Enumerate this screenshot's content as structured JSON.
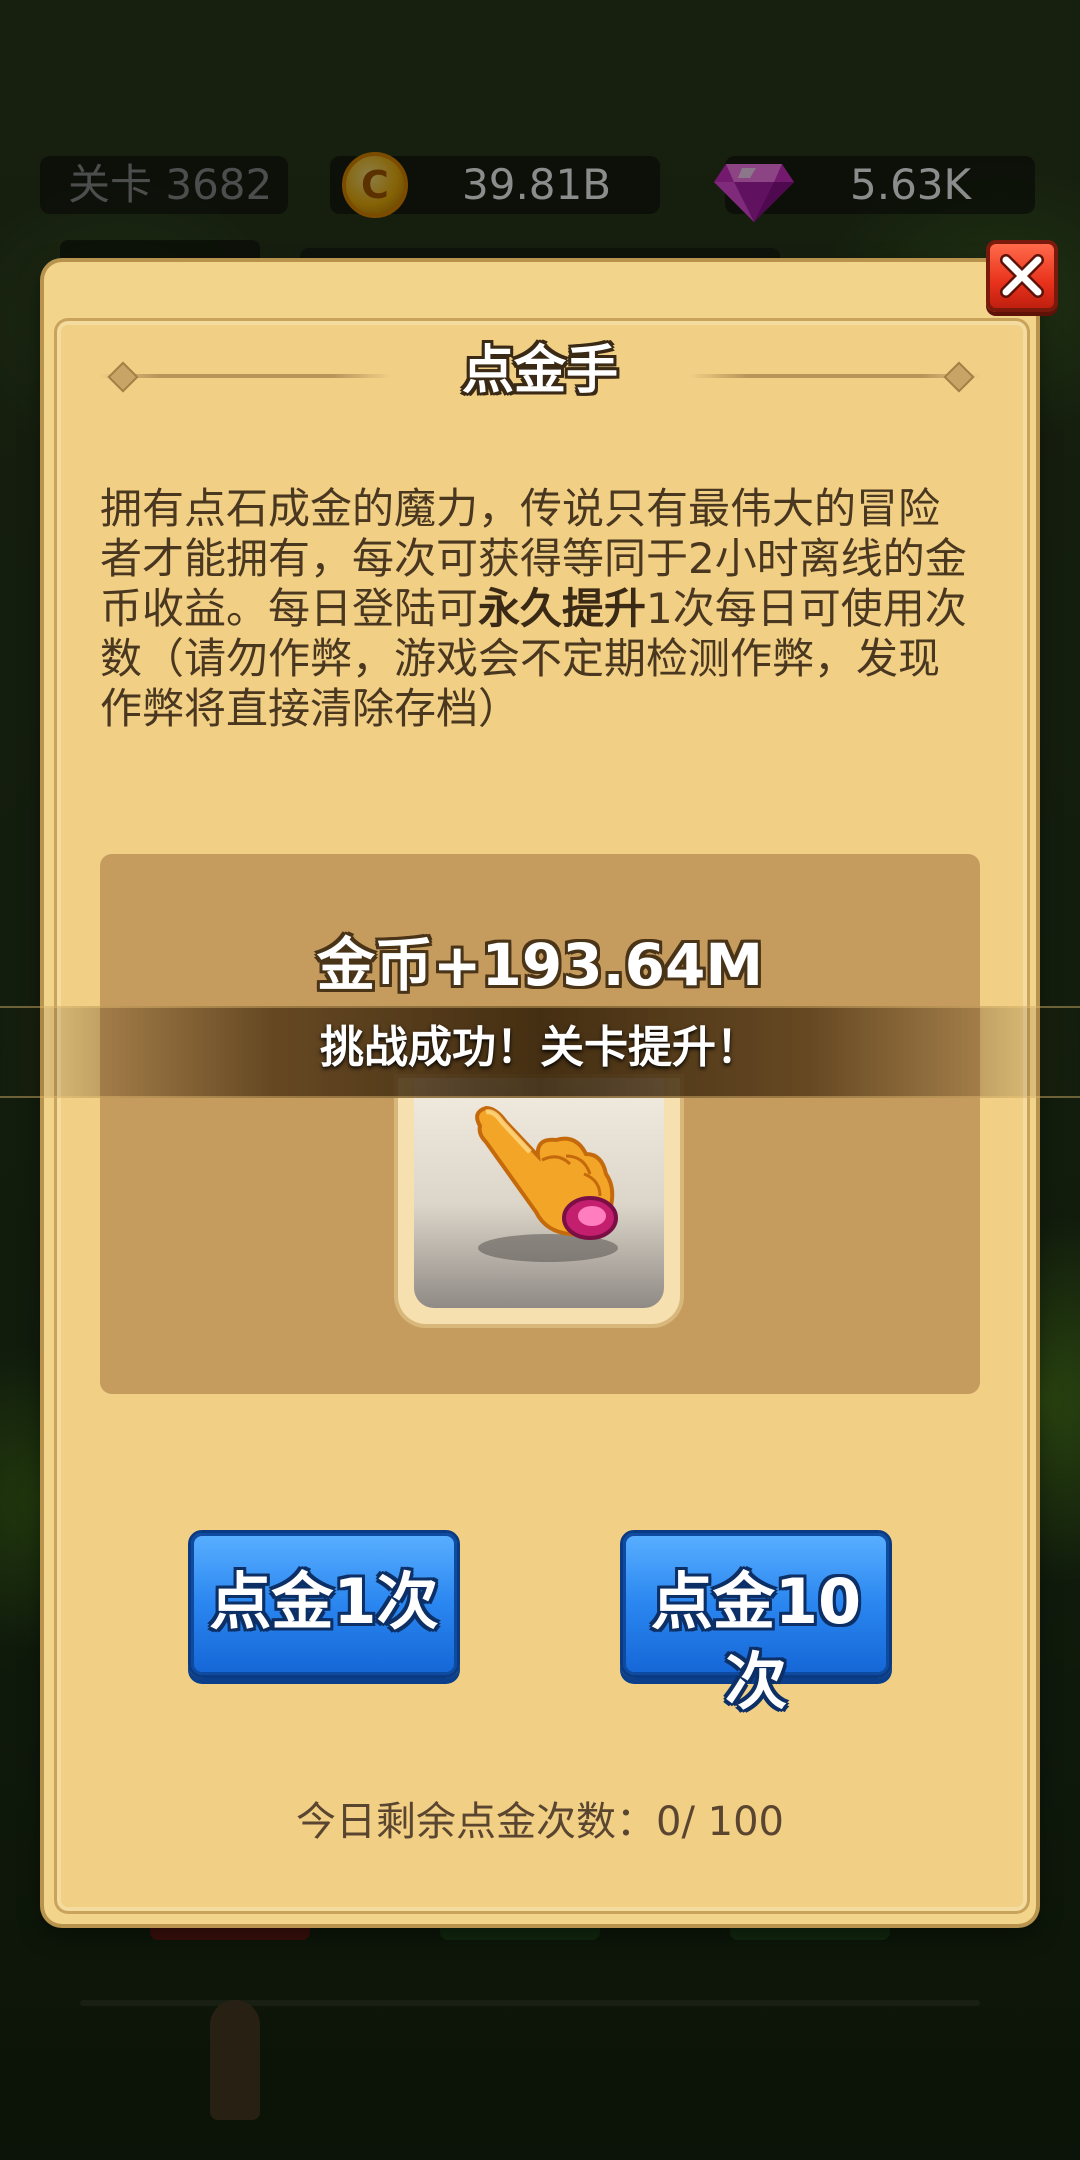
{
  "hud": {
    "level_text": "关卡 3682",
    "coins": "39.81B",
    "coin_symbol": "C",
    "gems": "5.63K",
    "coin_icon": "coin-icon",
    "gem_icon": "gem-icon"
  },
  "dialog": {
    "title": "点金手",
    "description_part1": "拥有点石成金的魔力，传说只有最伟大的冒险者才能拥有，每次可获得等同于2小时离线的金币收益。每日登陆可",
    "description_bold": "永久提升",
    "description_part2": "1次每日可使用次数（请勿作弊，游戏会不定期检测作弊，发现作弊将直接清除存档）",
    "reward_text": "金币+193.64M",
    "banner_text": "挑战成功！关卡提升！",
    "card_icon": "pointing-hand-icon",
    "button_once": "点金1次",
    "button_ten": "点金10次",
    "remaining_text": "今日剩余点金次数：0/ 100",
    "close_icon": "close-icon"
  },
  "colors": {
    "panel": "#f1cf85",
    "button_blue": "#2a86f0",
    "close_red": "#e8321c",
    "text_brown": "#4a3720"
  }
}
